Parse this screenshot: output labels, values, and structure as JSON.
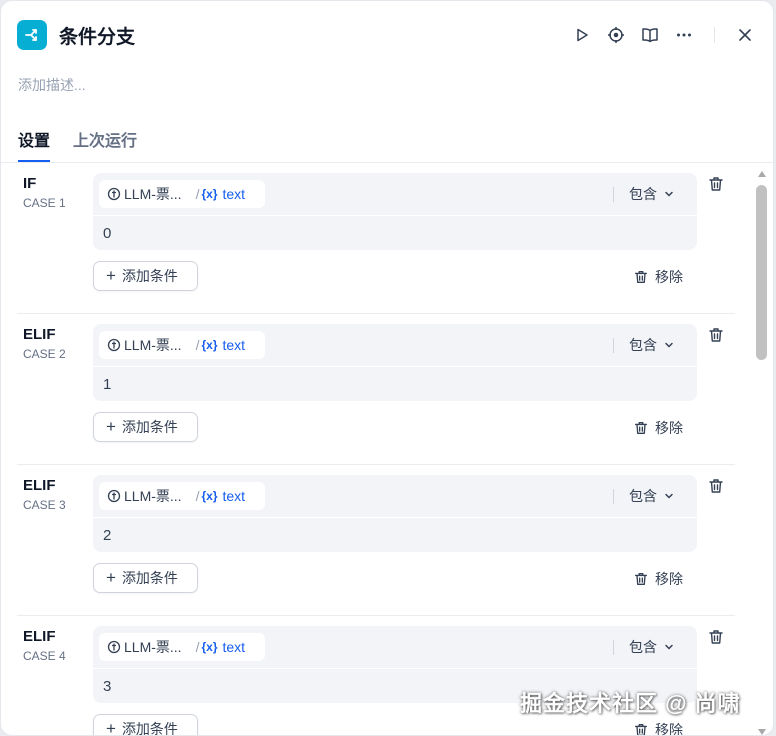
{
  "header": {
    "title": "条件分支",
    "icons": [
      "run-icon",
      "locate-icon",
      "book-icon",
      "more-icon",
      "close-icon"
    ],
    "accent": "#06aed4"
  },
  "description_placeholder": "添加描述...",
  "tabs": [
    {
      "label": "设置",
      "active": true
    },
    {
      "label": "上次运行",
      "active": false
    }
  ],
  "cases": [
    {
      "keyword": "IF",
      "case_label": "CASE 1",
      "node": "LLM-票...",
      "slash": "/",
      "var_icon": "{x}",
      "variable": "text",
      "operator": "包含",
      "value": "0",
      "add_label": "添加条件",
      "remove_label": "移除"
    },
    {
      "keyword": "ELIF",
      "case_label": "CASE 2",
      "node": "LLM-票...",
      "slash": "/",
      "var_icon": "{x}",
      "variable": "text",
      "operator": "包含",
      "value": "1",
      "add_label": "添加条件",
      "remove_label": "移除"
    },
    {
      "keyword": "ELIF",
      "case_label": "CASE 3",
      "node": "LLM-票...",
      "slash": "/",
      "var_icon": "{x}",
      "variable": "text",
      "operator": "包含",
      "value": "2",
      "add_label": "添加条件",
      "remove_label": "移除"
    },
    {
      "keyword": "ELIF",
      "case_label": "CASE 4",
      "node": "LLM-票...",
      "slash": "/",
      "var_icon": "{x}",
      "variable": "text",
      "operator": "包含",
      "value": "3",
      "add_label": "添加条件",
      "remove_label": "移除"
    }
  ],
  "watermark": "掘金技术社区 @ 尚啸",
  "colors": {
    "link": "#155eef",
    "muted": "#667085"
  }
}
